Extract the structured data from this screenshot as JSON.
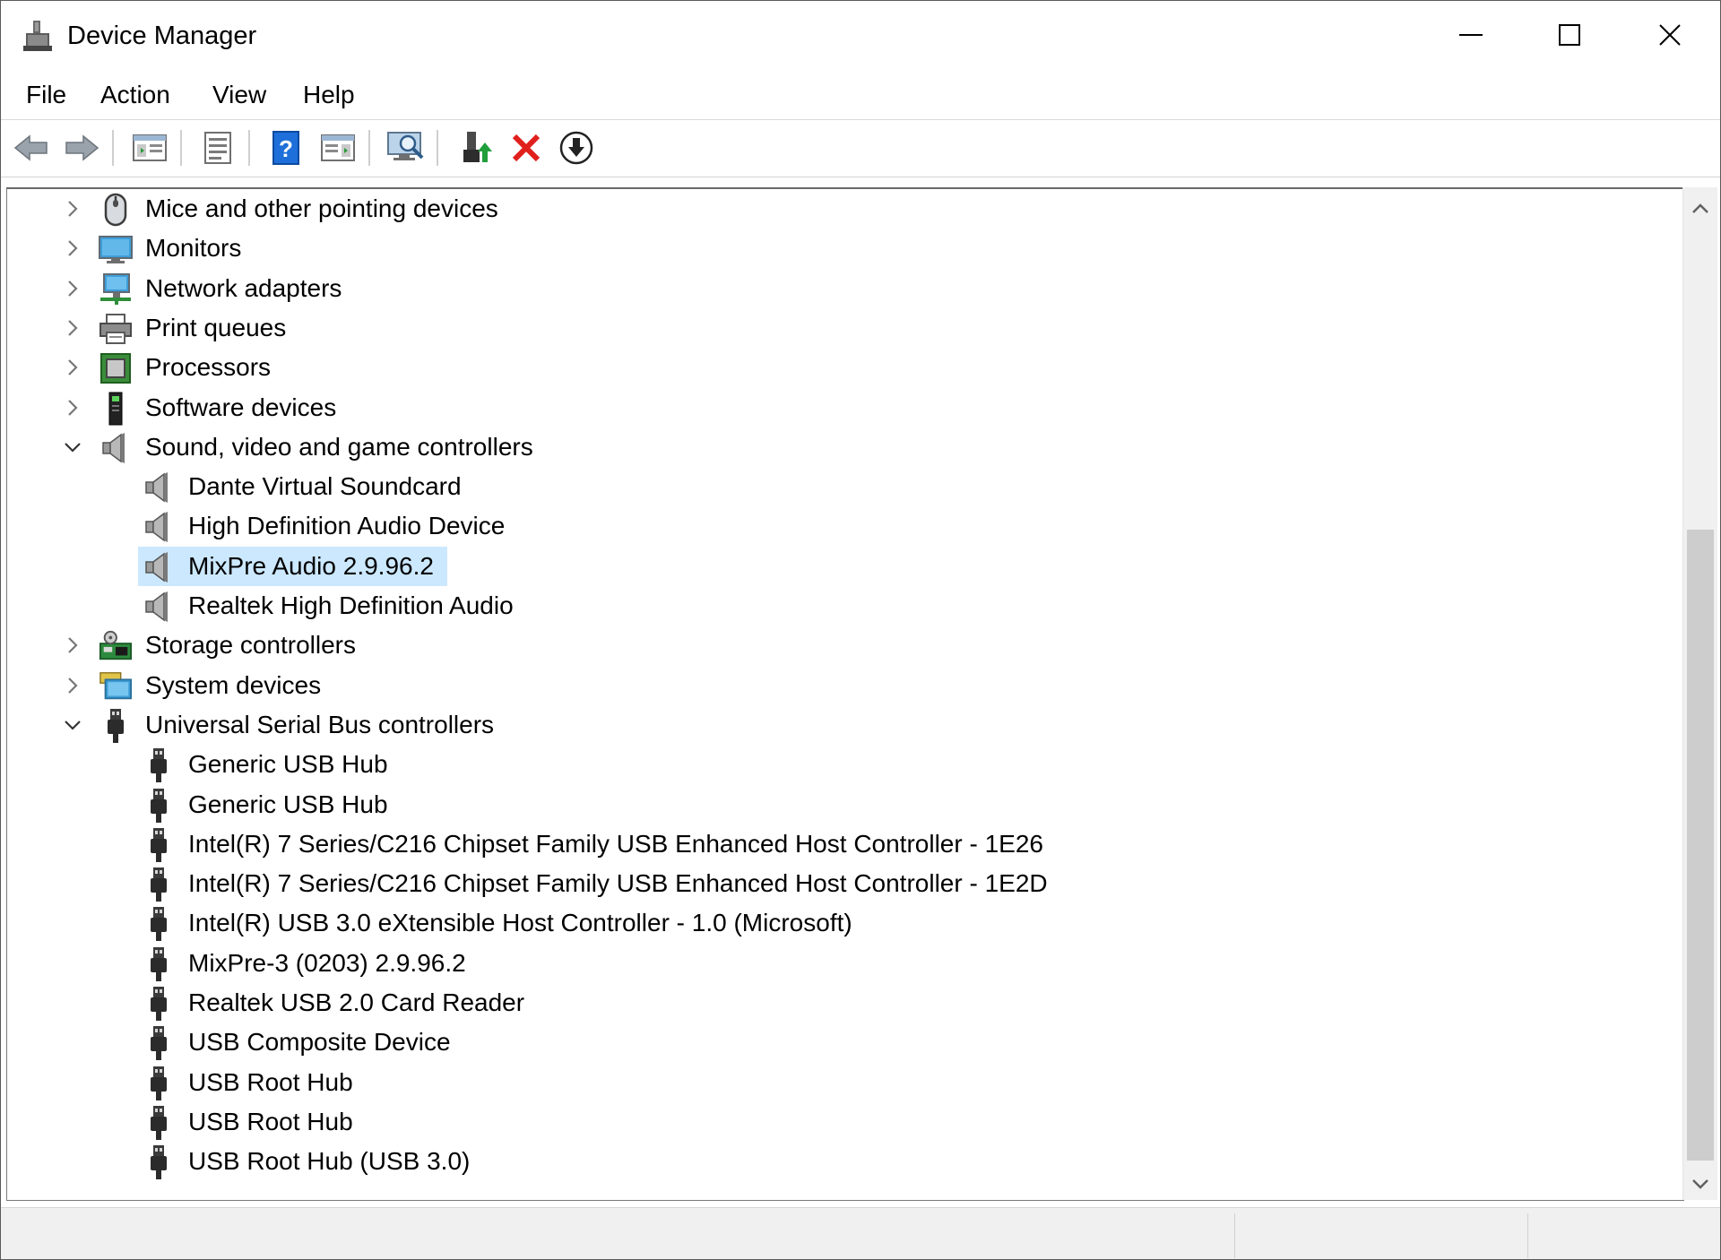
{
  "window": {
    "title": "Device Manager",
    "controls": {
      "minimize": "minimize",
      "maximize": "maximize",
      "close": "close"
    }
  },
  "menu": [
    "File",
    "Action",
    "View",
    "Help"
  ],
  "toolbar": [
    "back-icon",
    "forward-icon",
    "show-hide-console-tree-icon",
    "properties-icon",
    "help-icon",
    "action-pane-icon",
    "scan-for-hardware-changes-icon",
    "update-driver-icon",
    "uninstall-device-icon",
    "disable-device-icon"
  ],
  "tree": {
    "selected": "MixPre Audio 2.9.96.2",
    "rows": [
      {
        "label": "Mice and other pointing devices",
        "level": 0,
        "state": "collapsed",
        "icon": "mouse-icon"
      },
      {
        "label": "Monitors",
        "level": 0,
        "state": "collapsed",
        "icon": "monitor-icon"
      },
      {
        "label": "Network adapters",
        "level": 0,
        "state": "collapsed",
        "icon": "network-adapter-icon"
      },
      {
        "label": "Print queues",
        "level": 0,
        "state": "collapsed",
        "icon": "printer-icon"
      },
      {
        "label": "Processors",
        "level": 0,
        "state": "collapsed",
        "icon": "processor-icon"
      },
      {
        "label": "Software devices",
        "level": 0,
        "state": "collapsed",
        "icon": "software-device-icon"
      },
      {
        "label": "Sound, video and game controllers",
        "level": 0,
        "state": "expanded",
        "icon": "speaker-icon"
      },
      {
        "label": "Dante Virtual Soundcard",
        "level": 1,
        "icon": "speaker-icon"
      },
      {
        "label": "High Definition Audio Device",
        "level": 1,
        "icon": "speaker-icon"
      },
      {
        "label": "MixPre Audio 2.9.96.2",
        "level": 1,
        "icon": "speaker-icon",
        "selected": true
      },
      {
        "label": "Realtek High Definition Audio",
        "level": 1,
        "icon": "speaker-icon"
      },
      {
        "label": "Storage controllers",
        "level": 0,
        "state": "collapsed",
        "icon": "storage-controller-icon"
      },
      {
        "label": "System devices",
        "level": 0,
        "state": "collapsed",
        "icon": "system-device-icon"
      },
      {
        "label": "Universal Serial Bus controllers",
        "level": 0,
        "state": "expanded",
        "icon": "usb-plug-icon"
      },
      {
        "label": "Generic USB Hub",
        "level": 1,
        "icon": "usb-plug-icon"
      },
      {
        "label": "Generic USB Hub",
        "level": 1,
        "icon": "usb-plug-icon"
      },
      {
        "label": "Intel(R) 7 Series/C216 Chipset Family USB Enhanced Host Controller - 1E26",
        "level": 1,
        "icon": "usb-plug-icon"
      },
      {
        "label": "Intel(R) 7 Series/C216 Chipset Family USB Enhanced Host Controller - 1E2D",
        "level": 1,
        "icon": "usb-plug-icon"
      },
      {
        "label": "Intel(R) USB 3.0 eXtensible Host Controller - 1.0 (Microsoft)",
        "level": 1,
        "icon": "usb-plug-icon"
      },
      {
        "label": "MixPre-3 (0203) 2.9.96.2",
        "level": 1,
        "icon": "usb-plug-icon"
      },
      {
        "label": "Realtek USB 2.0 Card Reader",
        "level": 1,
        "icon": "usb-plug-icon"
      },
      {
        "label": "USB Composite Device",
        "level": 1,
        "icon": "usb-plug-icon"
      },
      {
        "label": "USB Root Hub",
        "level": 1,
        "icon": "usb-plug-icon"
      },
      {
        "label": "USB Root Hub",
        "level": 1,
        "icon": "usb-plug-icon"
      },
      {
        "label": "USB Root Hub (USB 3.0)",
        "level": 1,
        "icon": "usb-plug-icon"
      }
    ]
  },
  "colors": {
    "selection": "#cce8ff",
    "accent_blue": "#1e6fd9",
    "delete_red": "#e0201c",
    "update_green": "#1f9e3a"
  }
}
